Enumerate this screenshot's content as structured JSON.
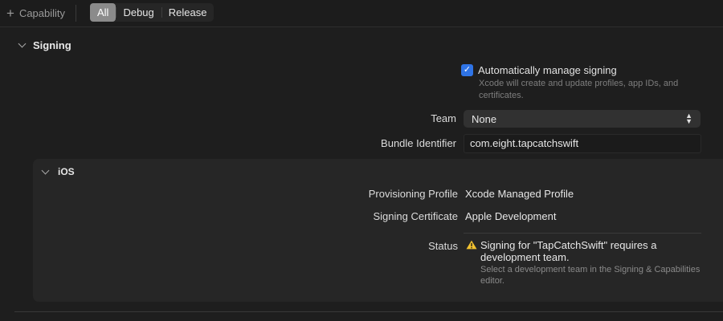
{
  "toolbar": {
    "capability_label": "Capability",
    "filters": [
      "All",
      "Debug",
      "Release"
    ],
    "active_filter": "All"
  },
  "signing": {
    "title": "Signing",
    "auto_manage": {
      "checked": true,
      "label": "Automatically manage signing",
      "description": "Xcode will create and update profiles, app IDs, and certificates."
    },
    "team": {
      "label": "Team",
      "value": "None"
    },
    "bundle": {
      "label": "Bundle Identifier",
      "value": "com.eight.tapcatchswift"
    }
  },
  "ios": {
    "title": "iOS",
    "provisioning": {
      "label": "Provisioning Profile",
      "value": "Xcode Managed Profile"
    },
    "certificate": {
      "label": "Signing Certificate",
      "value": "Apple Development"
    },
    "status": {
      "label": "Status",
      "title": "Signing for \"TapCatchSwift\" requires a development team.",
      "description": "Select a development team in the Signing & Capabilities editor."
    }
  },
  "colors": {
    "background": "#1e1e1e",
    "panel": "#262626",
    "accent": "#2f74e6",
    "warning": "#f2c230"
  },
  "icons": [
    "plus-icon",
    "chevron-down-icon",
    "checkmark-icon",
    "updown-icon",
    "warning-icon"
  ]
}
